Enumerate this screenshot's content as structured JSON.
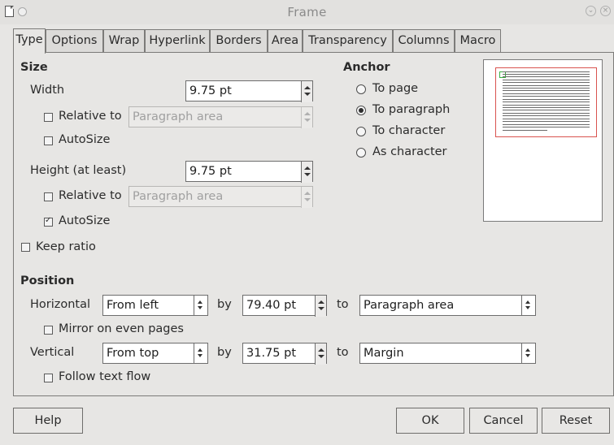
{
  "window": {
    "title": "Frame"
  },
  "tabs": [
    "Type",
    "Options",
    "Wrap",
    "Hyperlink",
    "Borders",
    "Area",
    "Transparency",
    "Columns",
    "Macro"
  ],
  "size": {
    "heading": "Size",
    "width_label": "Width",
    "width_value": "9.75 pt",
    "width_relative_label": "Relative to",
    "width_relative_value": "Paragraph area",
    "width_autosize_label": "AutoSize",
    "height_label": "Height (at least)",
    "height_value": "9.75 pt",
    "height_relative_label": "Relative to",
    "height_relative_value": "Paragraph area",
    "height_autosize_label": "AutoSize",
    "keep_ratio_label": "Keep ratio"
  },
  "checks": {
    "width_relative": false,
    "width_autosize": false,
    "height_relative": false,
    "height_autosize": true,
    "keep_ratio": false,
    "mirror": false,
    "follow_text_flow": false
  },
  "anchor": {
    "heading": "Anchor",
    "options": [
      "To page",
      "To paragraph",
      "To character",
      "As character"
    ],
    "selected": "To paragraph"
  },
  "position": {
    "heading": "Position",
    "horizontal_label": "Horizontal",
    "horizontal_value": "From left",
    "by_label": "by",
    "horizontal_by_value": "79.40 pt",
    "to_label": "to",
    "horizontal_to_value": "Paragraph area",
    "mirror_label": "Mirror on even pages",
    "vertical_label": "Vertical",
    "vertical_value": "From top",
    "vertical_by_value": "31.75 pt",
    "vertical_to_value": "Margin",
    "follow_label": "Follow text flow"
  },
  "buttons": {
    "help": "Help",
    "ok": "OK",
    "cancel": "Cancel",
    "reset": "Reset"
  }
}
